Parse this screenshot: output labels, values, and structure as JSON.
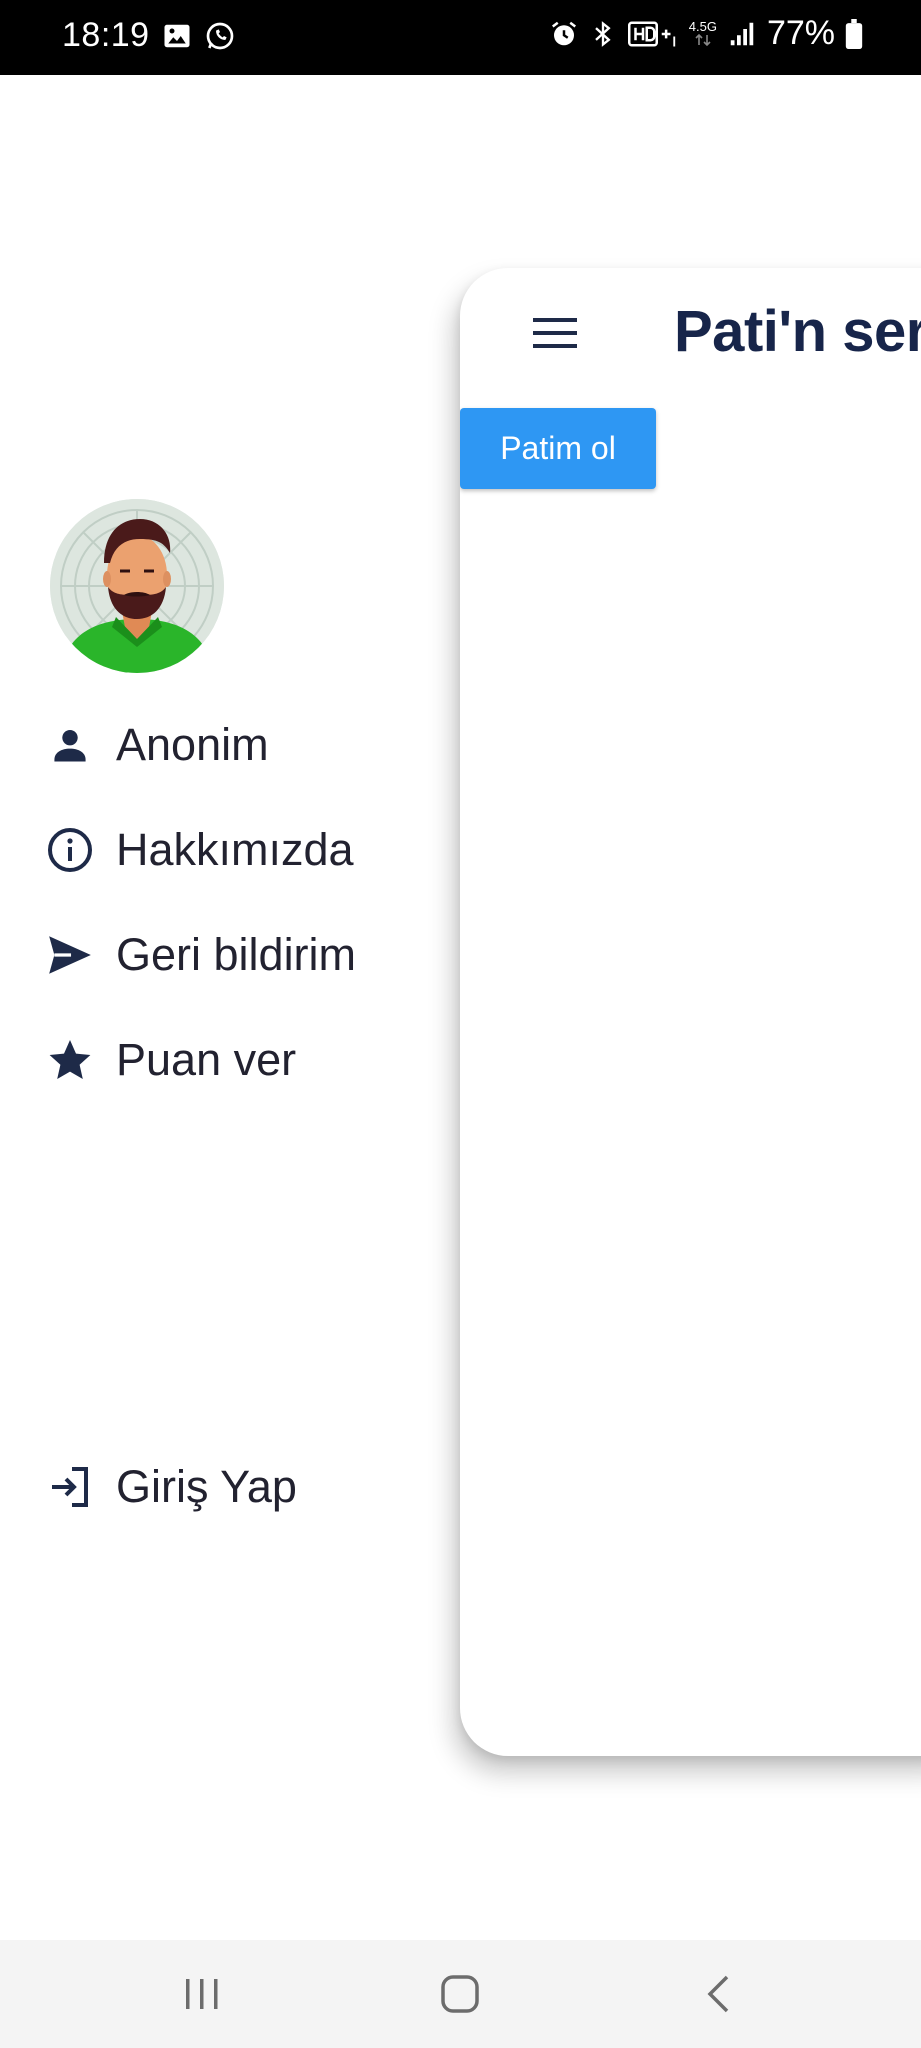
{
  "status_bar": {
    "time": "18:19",
    "battery_text": "77%",
    "network_label": "4.5G",
    "icons": [
      "gallery-icon",
      "whatsapp-icon",
      "alarm-icon",
      "bluetooth-icon",
      "hd-voice-icon",
      "network-icon",
      "signal-icon",
      "battery-icon"
    ]
  },
  "drawer": {
    "avatar_icon": "avatar-illustration",
    "items": [
      {
        "label": "Anonim",
        "icon": "person-icon"
      },
      {
        "label": "Hakkımızda",
        "icon": "info-icon"
      },
      {
        "label": "Geri bildirim",
        "icon": "send-icon"
      },
      {
        "label": "Puan ver",
        "icon": "star-icon"
      }
    ],
    "login": {
      "label": "Giriş Yap",
      "icon": "login-icon"
    }
  },
  "main": {
    "title": "Pati'n ser",
    "menu_icon": "hamburger-menu-icon",
    "button_label": "Patim ol"
  },
  "nav_bar": {
    "icons": [
      "recent-apps-icon",
      "home-icon",
      "back-icon"
    ]
  },
  "colors": {
    "accent": "#2e97f3",
    "title": "#17254a",
    "icon": "#1e2a48",
    "status_bar": "#000000",
    "nav_bar": "#f4f4f4"
  }
}
